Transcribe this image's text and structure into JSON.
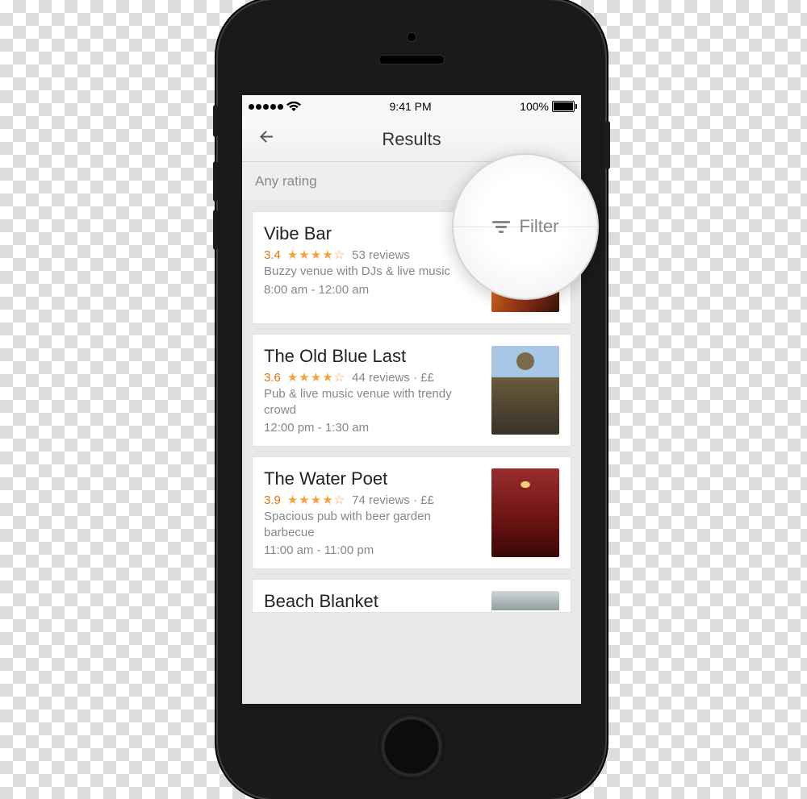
{
  "status_bar": {
    "time": "9:41 PM",
    "battery_pct": "100%"
  },
  "nav": {
    "title": "Results"
  },
  "filter_bar": {
    "rating_label": "Any rating"
  },
  "magnify": {
    "label": "Filter"
  },
  "results": [
    {
      "name": "Vibe Bar",
      "rating": "3.4",
      "stars": "★★★★☆",
      "reviews": "53 reviews",
      "price": "",
      "desc": "Buzzy venue with DJs & live music",
      "hours": "8:00 am - 12:00 am"
    },
    {
      "name": "The Old Blue Last",
      "rating": "3.6",
      "stars": "★★★★☆",
      "reviews": "44 reviews",
      "price": "££",
      "desc": "Pub & live music venue with trendy crowd",
      "hours": "12:00 pm - 1:30 am"
    },
    {
      "name": "The Water Poet",
      "rating": "3.9",
      "stars": "★★★★☆",
      "reviews": "74 reviews",
      "price": "££",
      "desc": "Spacious pub with beer garden barbecue",
      "hours": "11:00 am - 11:00 pm"
    },
    {
      "name": "Beach Blanket",
      "rating": "",
      "stars": "",
      "reviews": "",
      "price": "",
      "desc": "",
      "hours": ""
    }
  ]
}
